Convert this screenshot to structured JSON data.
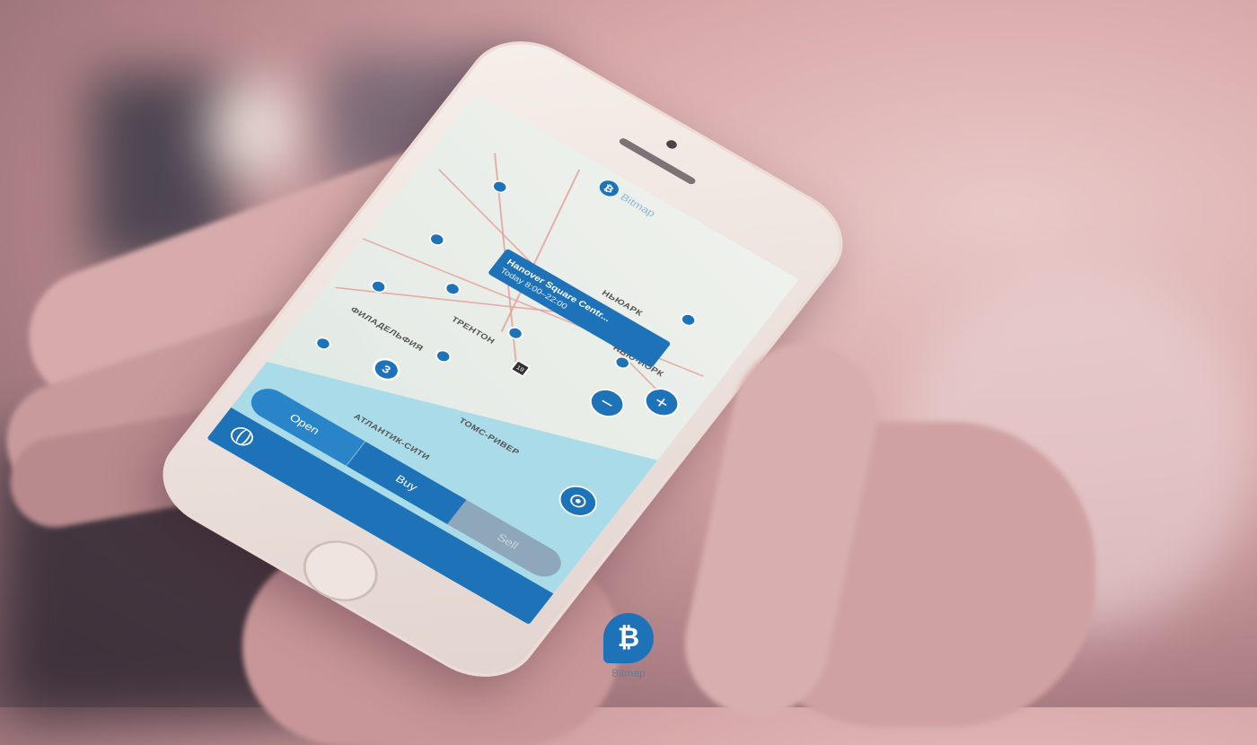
{
  "app": {
    "logo_text": "Bitmap",
    "logo_symbol": "₿"
  },
  "callout": {
    "title": "Hanover Square Centr...",
    "hours": "Today 8:00–22:00"
  },
  "map": {
    "labels": [
      "НЬЮАРК",
      "НЬЮ-ЙОРК",
      "ТРЕНТОН",
      "ФИЛАДЕЛЬФИЯ",
      "ТОМС-РИВЕР",
      "АТЛАНТИК-СИТИ"
    ],
    "cluster_count": "3",
    "marker_badge": "19"
  },
  "controls": {
    "zoom_in": "+",
    "zoom_out": "−"
  },
  "filters": {
    "open": "Open",
    "buy": "Buy",
    "sell": "Sell"
  },
  "colors": {
    "brand_blue": "#1e73b8",
    "water": "#a9dbe9",
    "road": "#e59b97"
  },
  "watermark": {
    "symbol": "₿",
    "text": "Bitmap"
  }
}
